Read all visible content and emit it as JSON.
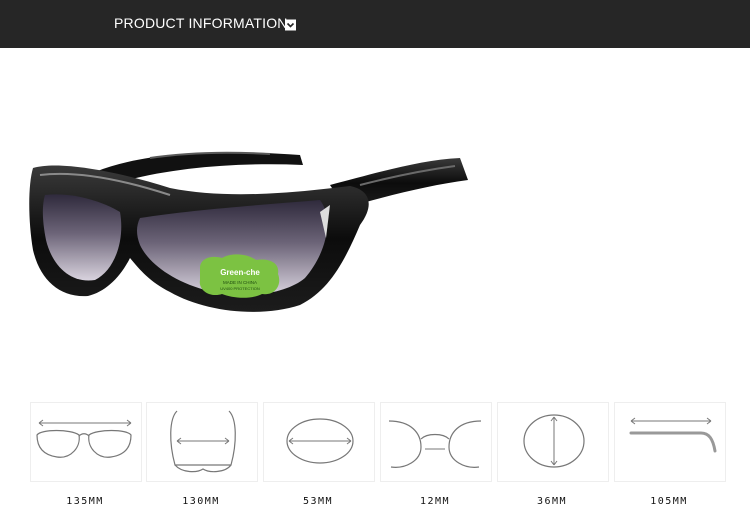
{
  "header": {
    "title": "PRODUCT INFORMATION",
    "dropdown_icon": "chevron-down-icon",
    "background": "#262626"
  },
  "product": {
    "badge_brand": "Green-che",
    "badge_line1": "MADE IN CHINA",
    "badge_line2": "UV400 PROTECTION",
    "badge_color": "#7cc242"
  },
  "dimensions": [
    {
      "icon": "frame-width-icon",
      "value": "135MM"
    },
    {
      "icon": "temple-width-icon",
      "value": "130MM"
    },
    {
      "icon": "lens-width-icon",
      "value": "53MM"
    },
    {
      "icon": "bridge-width-icon",
      "value": "12MM"
    },
    {
      "icon": "lens-height-icon",
      "value": "36MM"
    },
    {
      "icon": "temple-length-icon",
      "value": "105MM"
    }
  ]
}
